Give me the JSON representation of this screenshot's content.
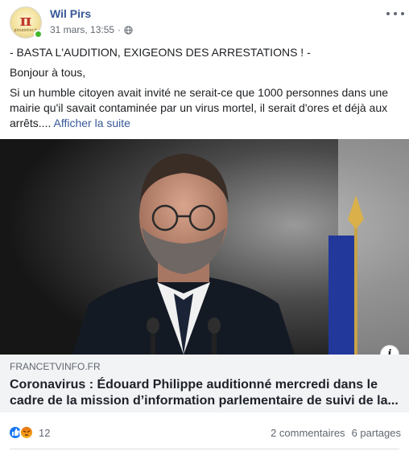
{
  "post": {
    "author": "Wil Pirs",
    "avatar_text": "π",
    "avatar_subtitle": "pirsatelier.fr",
    "date": "31 mars, 13:55",
    "separator": "·",
    "privacy_icon": "globe-icon",
    "more_icon": "more-horizontal-icon",
    "text": {
      "headline": "- BASTA L'AUDITION, EXIGEONS DES ARRESTATIONS ! -",
      "greeting": "Bonjour à tous,",
      "body": "Si un humble citoyen avait invité ne serait-ce que 1000 personnes dans une mairie qu'il savait contaminée par un virus mortel, il serait d'ores et déjà aux arrêts....",
      "see_more": "Afficher la suite"
    }
  },
  "link_preview": {
    "domain": "FRANCETVINFO.FR",
    "title": "Coronavirus : Édouard Philippe auditionné mercredi dans le cadre de la mission d’information parlementaire de suivi de la...",
    "info_icon": "info-icon"
  },
  "footer": {
    "reaction_icons": [
      "like-icon",
      "angry-icon"
    ],
    "reaction_count": "12",
    "comments": "2 commentaires",
    "shares": "6 partages"
  },
  "colors": {
    "author_link": "#385898",
    "secondary_text": "#606770",
    "link_meta_bg": "#f2f3f5",
    "like_blue": "#1877f2",
    "online_green": "#42b72a"
  }
}
